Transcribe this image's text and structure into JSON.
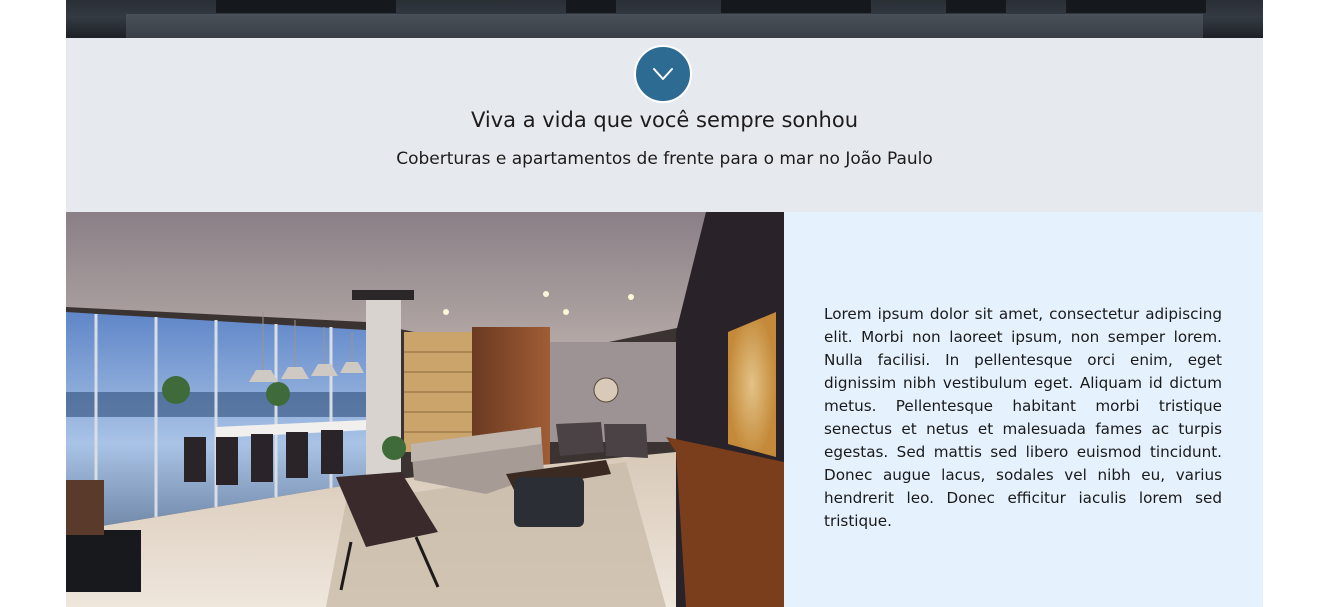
{
  "intro": {
    "headline": "Viva a vida que você sempre sonhou",
    "subline": "Coberturas e apartamentos de frente para o mar no João Paulo",
    "scroll_button_icon": "chevron-down-icon",
    "accent_color": "#2e6b93",
    "background_color": "#e6e9ed"
  },
  "feature": {
    "image_alt": "",
    "body": "Lorem ipsum dolor sit amet, consectetur adipiscing elit. Morbi non laoreet ipsum, non semper lorem. Nulla facilisi. In pellentesque orci enim, eget dignissim nibh vestibulum eget. Aliquam id dictum metus. Pellentesque habitant morbi tristique senectus et netus et malesuada fames ac turpis egestas. Sed mattis sed libero euismod tincidunt. Donec augue lacus, sodales vel nibh eu, varius hendrerit leo. Donec efficitur iaculis lorem sed tristique.",
    "text_panel_color": "#e5f1fd"
  }
}
